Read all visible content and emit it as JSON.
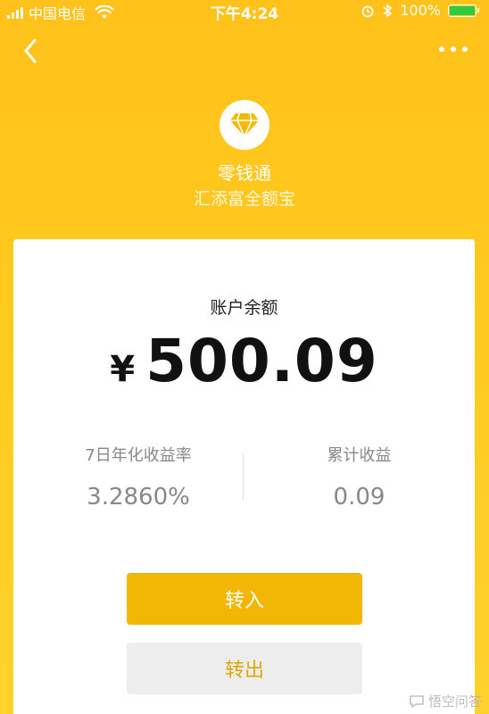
{
  "status_bar": {
    "carrier": "中国电信",
    "time": "下午4:24",
    "battery_text": "100%",
    "battery_level": 1.0
  },
  "nav": {
    "back_icon": "chevron-left-icon",
    "more_icon": "more-dots-icon"
  },
  "product": {
    "logo_icon": "diamond-icon",
    "name": "零钱通",
    "fund": "汇添富全额宝"
  },
  "account": {
    "balance_label": "账户余额",
    "currency": "¥",
    "balance": "500.09"
  },
  "stats": {
    "yield_label": "7日年化收益率",
    "yield_value": "3.2860%",
    "earnings_label": "累计收益",
    "earnings_value": "0.09"
  },
  "actions": {
    "transfer_in": "转入",
    "transfer_out": "转出"
  },
  "watermark": {
    "text": "悟空问答"
  },
  "colors": {
    "brand_yellow": "#FFC21A",
    "button_primary": "#F2B705",
    "button_secondary_bg": "#EDEDED",
    "button_secondary_text": "#E0A800"
  }
}
